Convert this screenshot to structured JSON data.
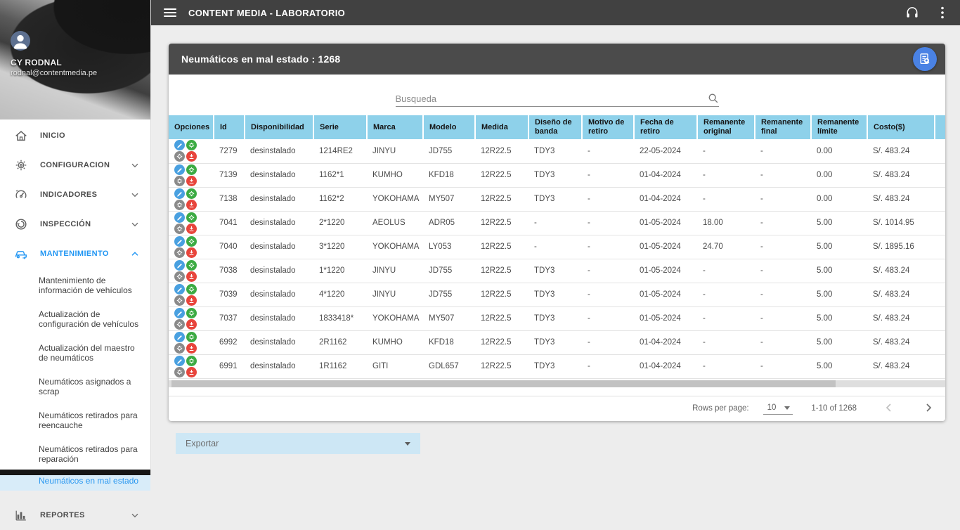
{
  "topbar": {
    "title": "CONTENT MEDIA - LABORATORIO"
  },
  "sidebar": {
    "user": {
      "name": "CY RODNAL",
      "email": "rodnal@contentmedia.pe"
    },
    "menu": [
      {
        "label": "INICIO",
        "icon": "home-icon",
        "expandable": false,
        "active": false
      },
      {
        "label": "CONFIGURACION",
        "icon": "gear-icon",
        "expandable": true,
        "state": "collapsed",
        "active": false
      },
      {
        "label": "INDICADORES",
        "icon": "gauge-icon",
        "expandable": true,
        "state": "collapsed",
        "active": false
      },
      {
        "label": "INSPECCIÓN",
        "icon": "inspection-icon",
        "expandable": true,
        "state": "collapsed",
        "active": false
      },
      {
        "label": "MANTENIMIENTO",
        "icon": "car-icon",
        "expandable": true,
        "state": "expanded",
        "active": true
      }
    ],
    "submenu": [
      {
        "label": "Mantenimiento de información de vehículos",
        "active": false
      },
      {
        "label": "Actualización de configuración de vehículos",
        "active": false
      },
      {
        "label": "Actualización del maestro de neumáticos",
        "active": false
      },
      {
        "label": "Neumáticos asignados a scrap",
        "active": false
      },
      {
        "label": "Neumáticos retirados para reencauche",
        "active": false
      },
      {
        "label": "Neumáticos retirados para reparación",
        "active": false
      },
      {
        "label": "Neumáticos en mal estado",
        "active": true
      }
    ],
    "reportes": {
      "label": "REPORTES",
      "icon": "bar-chart-icon",
      "state": "collapsed"
    }
  },
  "panel": {
    "title": "Neumáticos en mal estado : 1268",
    "search_placeholder": "Busqueda",
    "header_action_icon": "document-search-icon"
  },
  "table": {
    "headers": [
      "Opciones",
      "Id",
      "Disponibilidad",
      "Serie",
      "Marca",
      "Modelo",
      "Medida",
      "Diseño de banda",
      "Motivo de retiro",
      "Fecha de retiro",
      "Remanente original",
      "Remanente final",
      "Remanente límite",
      "Costo($)"
    ],
    "field_order": [
      "id",
      "disponibilidad",
      "serie",
      "marca",
      "modelo",
      "medida",
      "diseno_banda",
      "motivo_retiro",
      "fecha_retiro",
      "remanente_original",
      "remanente_final",
      "remanente_limite",
      "costo"
    ],
    "option_buttons": [
      {
        "name": "edit-button",
        "icon": "pencil-icon",
        "symbol": "sym-pencil",
        "color_class": "op-blue"
      },
      {
        "name": "settings-green-button",
        "icon": "gear-icon",
        "symbol": "sym-gear",
        "color_class": "op-green"
      },
      {
        "name": "settings-gray-button",
        "icon": "gear-icon",
        "symbol": "sym-gear",
        "color_class": "op-gray"
      },
      {
        "name": "download-button",
        "icon": "download-icon",
        "symbol": "sym-download",
        "color_class": "op-red"
      }
    ],
    "rows": [
      {
        "id": "7279",
        "disponibilidad": "desinstalado",
        "serie": "1214RE2",
        "marca": "JINYU",
        "modelo": "JD755",
        "medida": "12R22.5",
        "diseno_banda": "TDY3",
        "motivo_retiro": "-",
        "fecha_retiro": "22-05-2024",
        "remanente_original": "-",
        "remanente_final": "-",
        "remanente_limite": "0.00",
        "costo": "S/. 483.24"
      },
      {
        "id": "7139",
        "disponibilidad": "desinstalado",
        "serie": "1162*1",
        "marca": "KUMHO",
        "modelo": "KFD18",
        "medida": "12R22.5",
        "diseno_banda": "TDY3",
        "motivo_retiro": "-",
        "fecha_retiro": "01-04-2024",
        "remanente_original": "-",
        "remanente_final": "-",
        "remanente_limite": "0.00",
        "costo": "S/. 483.24"
      },
      {
        "id": "7138",
        "disponibilidad": "desinstalado",
        "serie": "1162*2",
        "marca": "YOKOHAMA",
        "modelo": "MY507",
        "medida": "12R22.5",
        "diseno_banda": "TDY3",
        "motivo_retiro": "-",
        "fecha_retiro": "01-04-2024",
        "remanente_original": "-",
        "remanente_final": "-",
        "remanente_limite": "0.00",
        "costo": "S/. 483.24"
      },
      {
        "id": "7041",
        "disponibilidad": "desinstalado",
        "serie": "2*1220",
        "marca": "AEOLUS",
        "modelo": "ADR05",
        "medida": "12R22.5",
        "diseno_banda": "-",
        "motivo_retiro": "-",
        "fecha_retiro": "01-05-2024",
        "remanente_original": "18.00",
        "remanente_final": "-",
        "remanente_limite": "5.00",
        "costo": "S/. 1014.95"
      },
      {
        "id": "7040",
        "disponibilidad": "desinstalado",
        "serie": "3*1220",
        "marca": "YOKOHAMA",
        "modelo": "LY053",
        "medida": "12R22.5",
        "diseno_banda": "-",
        "motivo_retiro": "-",
        "fecha_retiro": "01-05-2024",
        "remanente_original": "24.70",
        "remanente_final": "-",
        "remanente_limite": "5.00",
        "costo": "S/. 1895.16"
      },
      {
        "id": "7038",
        "disponibilidad": "desinstalado",
        "serie": "1*1220",
        "marca": "JINYU",
        "modelo": "JD755",
        "medida": "12R22.5",
        "diseno_banda": "TDY3",
        "motivo_retiro": "-",
        "fecha_retiro": "01-05-2024",
        "remanente_original": "-",
        "remanente_final": "-",
        "remanente_limite": "5.00",
        "costo": "S/. 483.24"
      },
      {
        "id": "7039",
        "disponibilidad": "desinstalado",
        "serie": "4*1220",
        "marca": "JINYU",
        "modelo": "JD755",
        "medida": "12R22.5",
        "diseno_banda": "TDY3",
        "motivo_retiro": "-",
        "fecha_retiro": "01-05-2024",
        "remanente_original": "-",
        "remanente_final": "-",
        "remanente_limite": "5.00",
        "costo": "S/. 483.24"
      },
      {
        "id": "7037",
        "disponibilidad": "desinstalado",
        "serie": "1833418*",
        "marca": "YOKOHAMA",
        "modelo": "MY507",
        "medida": "12R22.5",
        "diseno_banda": "TDY3",
        "motivo_retiro": "-",
        "fecha_retiro": "01-05-2024",
        "remanente_original": "-",
        "remanente_final": "-",
        "remanente_limite": "5.00",
        "costo": "S/. 483.24"
      },
      {
        "id": "6992",
        "disponibilidad": "desinstalado",
        "serie": "2R1162",
        "marca": "KUMHO",
        "modelo": "KFD18",
        "medida": "12R22.5",
        "diseno_banda": "TDY3",
        "motivo_retiro": "-",
        "fecha_retiro": "01-04-2024",
        "remanente_original": "-",
        "remanente_final": "-",
        "remanente_limite": "5.00",
        "costo": "S/. 483.24"
      },
      {
        "id": "6991",
        "disponibilidad": "desinstalado",
        "serie": "1R1162",
        "marca": "GITI",
        "modelo": "GDL657",
        "medida": "12R22.5",
        "diseno_banda": "TDY3",
        "motivo_retiro": "-",
        "fecha_retiro": "01-04-2024",
        "remanente_original": "-",
        "remanente_final": "-",
        "remanente_limite": "5.00",
        "costo": "S/. 483.24"
      }
    ]
  },
  "pagination": {
    "rows_per_page_label": "Rows per page:",
    "rows_per_page_value": "10",
    "range": "1-10 of 1268"
  },
  "export": {
    "label": "Exportar"
  },
  "colors": {
    "accent_blue": "#2196f3",
    "topbar": "#414141",
    "panel_header": "#4b4b4b",
    "table_header": "#8ed1ea",
    "export_bg": "#cde7f5",
    "op_blue": "#49a0e0",
    "op_green": "#3cab43",
    "op_gray": "#8a8a8a",
    "op_red": "#e8453c"
  }
}
